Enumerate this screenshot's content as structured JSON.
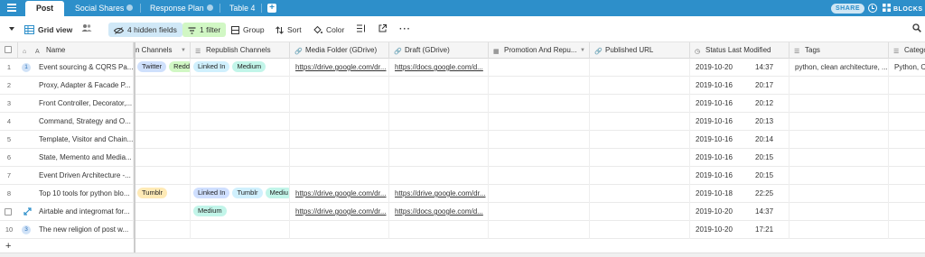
{
  "tabs": [
    {
      "label": "Post",
      "active": true
    },
    {
      "label": "Social Shares",
      "active": false
    },
    {
      "label": "Response Plan",
      "active": false
    },
    {
      "label": "Table 4",
      "active": false
    }
  ],
  "topbar_right": {
    "share": "SHARE",
    "blocks": "BLOCKS"
  },
  "toolbar": {
    "view_name": "Grid view",
    "hidden_fields": "4 hidden fields",
    "filter": "1 filter",
    "group": "Group",
    "sort": "Sort",
    "color": "Color"
  },
  "columns": [
    {
      "label": "Name"
    },
    {
      "label": "n Channels"
    },
    {
      "label": "Republish Channels"
    },
    {
      "label": "Media Folder (GDrive)"
    },
    {
      "label": "Draft (GDrive)"
    },
    {
      "label": "Promotion And Repu..."
    },
    {
      "label": "Published URL"
    },
    {
      "label": "Status Last Modified"
    },
    {
      "label": "Tags"
    },
    {
      "label": "Catego"
    }
  ],
  "rows": [
    {
      "num": "1",
      "badge": "1",
      "name": "Event sourcing & CQRS Pa...",
      "channels": [
        {
          "t": "Twitter",
          "c": "#cfe0fc"
        },
        {
          "t": "Redd",
          "c": "#d1f7c4"
        }
      ],
      "republish": [
        {
          "t": "Linked In",
          "c": "#d0f0fd"
        },
        {
          "t": "Medium",
          "c": "#c2f5e9"
        }
      ],
      "media": "https://drive.google.com/dr...",
      "draft": "https://docs.google.com/d...",
      "date": "2019-10-20",
      "time": "14:37",
      "tags": "python, clean architecture, ...",
      "cat": "Python, C"
    },
    {
      "num": "2",
      "badge": "",
      "name": "Proxy, Adapter & Facade P...",
      "channels": [],
      "republish": [],
      "media": "",
      "draft": "",
      "date": "2019-10-16",
      "time": "20:17",
      "tags": "",
      "cat": ""
    },
    {
      "num": "3",
      "badge": "",
      "name": "Front Controller, Decorator,...",
      "channels": [],
      "republish": [],
      "media": "",
      "draft": "",
      "date": "2019-10-16",
      "time": "20:12",
      "tags": "",
      "cat": ""
    },
    {
      "num": "4",
      "badge": "",
      "name": "Command, Strategy and O...",
      "channels": [],
      "republish": [],
      "media": "",
      "draft": "",
      "date": "2019-10-16",
      "time": "20:13",
      "tags": "",
      "cat": ""
    },
    {
      "num": "5",
      "badge": "",
      "name": "Template, Visitor and Chain...",
      "channels": [],
      "republish": [],
      "media": "",
      "draft": "",
      "date": "2019-10-16",
      "time": "20:14",
      "tags": "",
      "cat": ""
    },
    {
      "num": "6",
      "badge": "",
      "name": "State, Memento and Media...",
      "channels": [],
      "republish": [],
      "media": "",
      "draft": "",
      "date": "2019-10-16",
      "time": "20:15",
      "tags": "",
      "cat": ""
    },
    {
      "num": "7",
      "badge": "",
      "name": "Event Driven Architecture -...",
      "channels": [],
      "republish": [],
      "media": "",
      "draft": "",
      "date": "2019-10-16",
      "time": "20:15",
      "tags": "",
      "cat": ""
    },
    {
      "num": "8",
      "badge": "",
      "name": "Top 10 tools for python blo...",
      "channels": [
        {
          "t": "Tumblr",
          "c": "#ffeab6"
        }
      ],
      "republish": [
        {
          "t": "Linked In",
          "c": "#cfdfff"
        },
        {
          "t": "Tumblr",
          "c": "#d0f0fd"
        },
        {
          "t": "Mediu",
          "c": "#c2f5e9"
        }
      ],
      "media": "https://drive.google.com/dr...",
      "draft": "https://drive.google.com/dr...",
      "date": "2019-10-18",
      "time": "22:25",
      "tags": "",
      "cat": ""
    },
    {
      "num": "",
      "badge": "",
      "expand": true,
      "name": "Airtable and integromat for...",
      "channels": [],
      "republish": [
        {
          "t": "Medium",
          "c": "#c2f5e9"
        }
      ],
      "media": "https://drive.google.com/dr...",
      "draft": "https://docs.google.com/d...",
      "date": "2019-10-20",
      "time": "14:37",
      "tags": "",
      "cat": ""
    },
    {
      "num": "10",
      "badge": "3",
      "name": "The new religion of post w...",
      "channels": [],
      "republish": [],
      "media": "",
      "draft": "",
      "date": "2019-10-20",
      "time": "17:21",
      "tags": "",
      "cat": ""
    }
  ],
  "colors": {
    "topbar": "#2d8fca",
    "hidden_fields_bg": "#d0e8f7",
    "filter_bg": "#d1f7c4"
  }
}
